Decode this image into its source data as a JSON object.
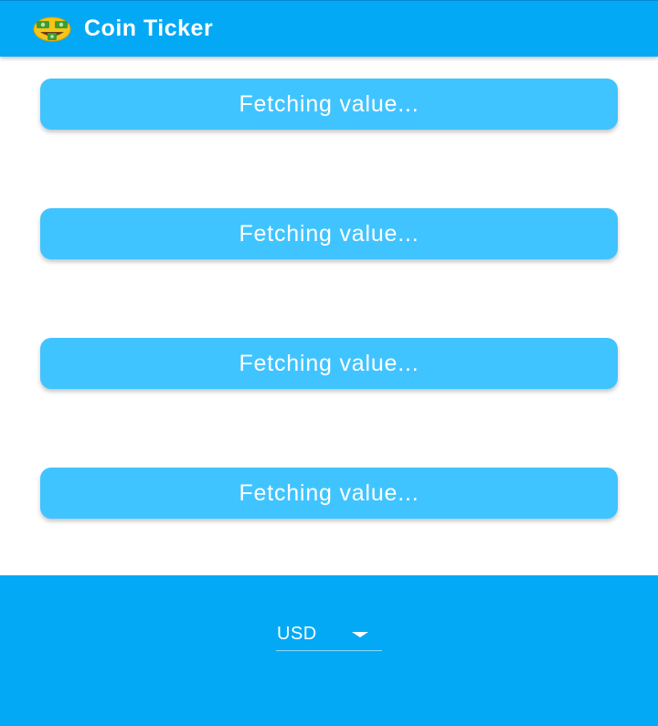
{
  "app_bar": {
    "title": "Coin Ticker",
    "icon": "money-mouth-face-icon"
  },
  "cards": [
    {
      "label": "Fetching value..."
    },
    {
      "label": "Fetching value..."
    },
    {
      "label": "Fetching value..."
    },
    {
      "label": "Fetching value..."
    }
  ],
  "footer": {
    "currency_selected": "USD"
  },
  "colors": {
    "primary": "#03a9f4",
    "card": "#40c4ff",
    "text_on_primary": "#ffffff"
  }
}
